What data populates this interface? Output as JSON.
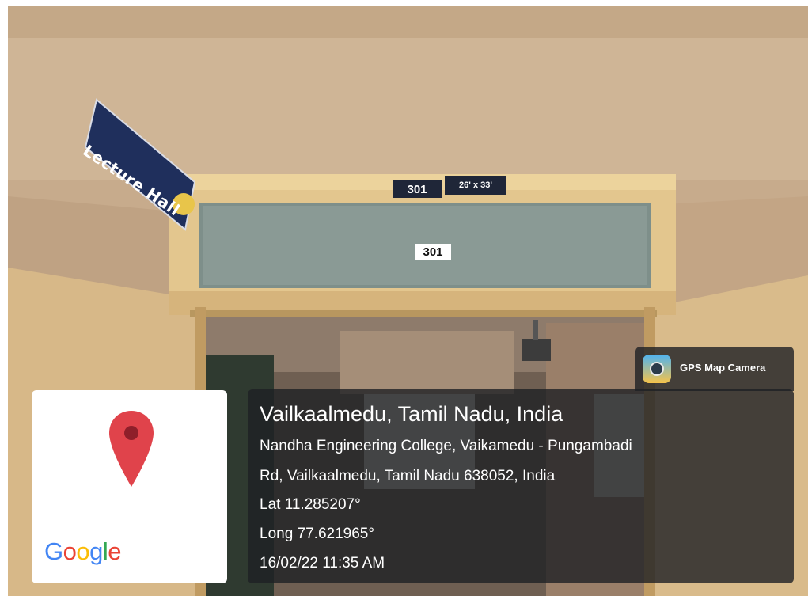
{
  "scene": {
    "sign_text": "Lecture Hall",
    "room_plate_number": "301",
    "room_plate_dimensions": "26' x 33'",
    "glass_number": "301"
  },
  "map_card": {
    "pin_icon": "map-pin-icon",
    "logo_text": "Google",
    "logo_colors": [
      "#4285F4",
      "#EA4335",
      "#FBBC05",
      "#4285F4",
      "#34A853",
      "#EA4335"
    ]
  },
  "gps_badge": {
    "icon": "camera-lens-icon",
    "label": "GPS Map Camera"
  },
  "info": {
    "title": "Vailkaalmedu, Tamil Nadu, India",
    "address_line1": "Nandha Engineering College, Vaikamedu - Pungambadi",
    "address_line2": "Rd, Vailkaalmedu, Tamil Nadu 638052, India",
    "lat": "Lat 11.285207°",
    "long": "Long 77.621965°",
    "datetime": "16/02/22 11:35 AM"
  },
  "colors": {
    "wall": "#c9ad8e",
    "frame": "#e6c98a",
    "sign_blue": "#1f2f5c",
    "pin_red": "#e0434b",
    "panel_bg": "#1e2124"
  }
}
